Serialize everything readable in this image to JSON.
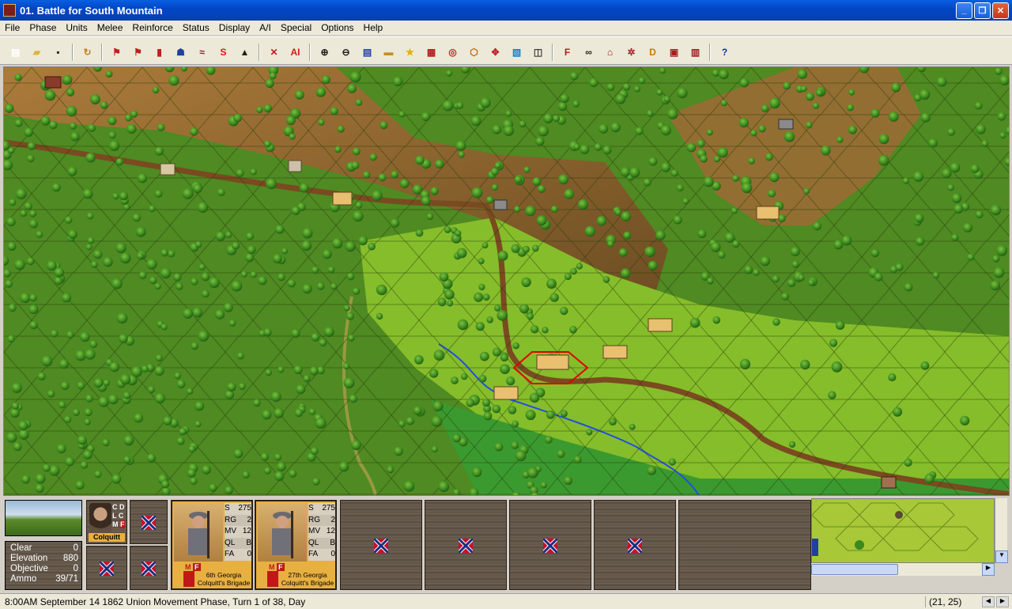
{
  "window": {
    "title": "01. Battle for South Mountain"
  },
  "menu": [
    "File",
    "Phase",
    "Units",
    "Melee",
    "Reinforce",
    "Status",
    "Display",
    "A/I",
    "Special",
    "Options",
    "Help"
  ],
  "toolbar": {
    "buttons": [
      {
        "name": "new-icon",
        "glyph": "▤",
        "color": "#ffffff"
      },
      {
        "name": "open-icon",
        "glyph": "▰",
        "color": "#e0b040"
      },
      {
        "name": "save-icon",
        "glyph": "▪",
        "color": "#2a2a2a"
      },
      {
        "name": "replay-icon",
        "glyph": "↻",
        "color": "#c08020"
      },
      {
        "name": "artillery-fire-icon",
        "glyph": "⚑",
        "color": "#c02020"
      },
      {
        "name": "fire-icon",
        "glyph": "⚑",
        "color": "#c02020"
      },
      {
        "name": "ammo-icon",
        "glyph": "▮",
        "color": "#c02020"
      },
      {
        "name": "infantry-icon",
        "glyph": "☗",
        "color": "#2040a0"
      },
      {
        "name": "cavalry-icon",
        "glyph": "≈",
        "color": "#802020"
      },
      {
        "name": "s-icon",
        "glyph": "S",
        "color": "#d01818"
      },
      {
        "name": "stack-icon",
        "glyph": "▲",
        "color": "#202020"
      },
      {
        "name": "no-fire-icon",
        "glyph": "✕",
        "color": "#c02020"
      },
      {
        "name": "ai-icon",
        "glyph": "AI",
        "color": "#d01818"
      },
      {
        "name": "zoom-in-icon",
        "glyph": "⊕",
        "color": "#202020"
      },
      {
        "name": "zoom-out-icon",
        "glyph": "⊖",
        "color": "#202020"
      },
      {
        "name": "report-icon",
        "glyph": "▤",
        "color": "#2040a0"
      },
      {
        "name": "counter-icon",
        "glyph": "▬",
        "color": "#c09020"
      },
      {
        "name": "star-icon",
        "glyph": "★",
        "color": "#e0b000"
      },
      {
        "name": "us-flag-icon",
        "glyph": "▦",
        "color": "#b02020"
      },
      {
        "name": "target-icon",
        "glyph": "◎",
        "color": "#c02020"
      },
      {
        "name": "hex-outline-icon",
        "glyph": "⬡",
        "color": "#c06000"
      },
      {
        "name": "move-arrows-icon",
        "glyph": "✥",
        "color": "#c02020"
      },
      {
        "name": "map-edit-icon",
        "glyph": "▧",
        "color": "#2080c0"
      },
      {
        "name": "layers-icon",
        "glyph": "◫",
        "color": "#404040"
      },
      {
        "name": "f-icon",
        "glyph": "F",
        "color": "#c01818"
      },
      {
        "name": "binoculars-icon",
        "glyph": "∞",
        "color": "#202020"
      },
      {
        "name": "cemetery-icon",
        "glyph": "⌂",
        "color": "#a02020"
      },
      {
        "name": "wheel-icon",
        "glyph": "✲",
        "color": "#a02020"
      },
      {
        "name": "d-icon",
        "glyph": "D",
        "color": "#c08000"
      },
      {
        "name": "orders-icon",
        "glyph": "▣",
        "color": "#a02020"
      },
      {
        "name": "flags-icon",
        "glyph": "▥",
        "color": "#a02020"
      },
      {
        "name": "help-icon",
        "glyph": "?",
        "color": "#1030b0"
      }
    ]
  },
  "terrain_info": {
    "rows": [
      {
        "label": "Clear",
        "value": "0"
      },
      {
        "label": "Elevation",
        "value": "880"
      },
      {
        "label": "Objective",
        "value": "0"
      },
      {
        "label": "Ammo",
        "value": "39/71"
      }
    ]
  },
  "leader": {
    "name": "Colquitt",
    "tags": [
      "C",
      "D",
      "L",
      "C",
      "M",
      "F"
    ]
  },
  "units": [
    {
      "stats": [
        [
          "S",
          "275"
        ],
        [
          "RG",
          "2"
        ],
        [
          "MV",
          "12"
        ],
        [
          "QL",
          "B"
        ],
        [
          "FA",
          "0"
        ]
      ],
      "badges": [
        "M",
        "F"
      ],
      "name": "6th Georgia",
      "brigade": "Colquitt's Brigade"
    },
    {
      "stats": [
        [
          "S",
          "275"
        ],
        [
          "RG",
          "2"
        ],
        [
          "MV",
          "12"
        ],
        [
          "QL",
          "B"
        ],
        [
          "FA",
          "0"
        ]
      ],
      "badges": [
        "M",
        "F"
      ],
      "name": "27th Georgia",
      "brigade": "Colquitt's Brigade"
    }
  ],
  "status": {
    "message": "8:00AM September 14 1862 Union Movement Phase, Turn 1 of 38, Day",
    "coords": "(21, 25)"
  },
  "colors": {
    "confederate_red": "#c8102e",
    "union_blue": "#1a2f80",
    "selection": "#e00000",
    "forest": "#3d7a1c",
    "clear_field": "#8cc230",
    "plowed": "#8a5a28",
    "road": "#7a4a20",
    "stream": "#2050e0"
  }
}
